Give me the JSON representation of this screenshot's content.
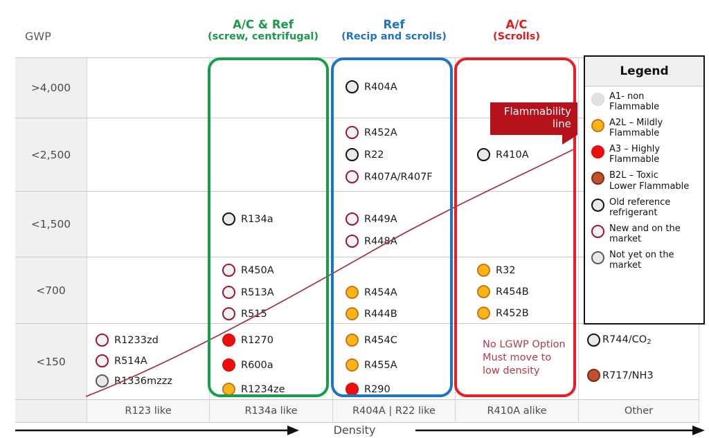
{
  "gwp_label": "GWP",
  "headers": [
    {
      "id": "green",
      "line1": "A/C & Ref",
      "line2": "(screw, centrifugal)",
      "color": "#1a9a4b"
    },
    {
      "id": "blue",
      "line1": "Ref",
      "line2": "(Recip and scrolls)",
      "color": "#1f72c4"
    },
    {
      "id": "red",
      "line1": "A/C",
      "line2": "(Scrolls)",
      "color": "#e01b1b"
    }
  ],
  "gwp_rows": [
    "&gt;4,000",
    "&lt;2,500",
    "&lt;1,500",
    "&lt;700",
    "&lt;150"
  ],
  "gwp_rows_plain": [
    ">4,000",
    "<2,500",
    "<1,500",
    "<700",
    "<150"
  ],
  "columns_footer": [
    "",
    "R123 like",
    "R134a like",
    "R404A | R22 like",
    "R410A alike",
    "Other"
  ],
  "density_label": "Density",
  "callout": {
    "line1": "Flammability",
    "line2": "line",
    "color": "#b5121b"
  },
  "no_lgwp_note": {
    "line1": "No LGWP Option",
    "line2": "Must move to",
    "line3": "low density",
    "color": "#b5394a"
  },
  "legend": {
    "title": "Legend",
    "entries": [
      {
        "class": "a1",
        "swatch": "a1-plain",
        "line1": "A1- non",
        "line2": "Flammable",
        "color": "#e0e2e6"
      },
      {
        "class": "a2l",
        "swatch": "a2l",
        "line1": "A2L – Mildly",
        "line2": "Flammable",
        "color": "#fcb415"
      },
      {
        "class": "a3",
        "swatch": "a3",
        "line1": "A3 – Highly",
        "line2": "Flammable",
        "color": "#f20d0d"
      },
      {
        "class": "b2l",
        "swatch": "b2l",
        "line1": "B2L – Toxic",
        "line2": "Lower Flammable",
        "color": "#c0512c"
      },
      {
        "class": "old",
        "swatch": "a1-old",
        "line1": "Old reference",
        "line2": "refrigerant",
        "color": "#111111"
      },
      {
        "class": "new",
        "swatch": "a1-new",
        "line1": "New and on the",
        "line2": "market",
        "color": "#9e1430"
      },
      {
        "class": "notyet",
        "swatch": "a1-not",
        "line1": "Not yet on the",
        "line2": "market",
        "color": "#595959"
      }
    ]
  },
  "chart_data": {
    "type": "table",
    "title": "Refrigerant GWP vs Density / Application Matrix",
    "xlabel": "Density",
    "ylabel": "GWP",
    "row_categories": [
      ">4,000",
      "<2,500",
      "<1,500",
      "<700",
      "<150"
    ],
    "column_categories": [
      "R123 like",
      "R134a like",
      "R404A | R22 like",
      "R410A alike",
      "Other"
    ],
    "application_groups": [
      {
        "label": "A/C & Ref (screw, centrifugal)",
        "columns": [
          "R134a like"
        ],
        "color": "#14a04a"
      },
      {
        "label": "Ref (Recip and scrolls)",
        "columns": [
          "R404A | R22 like"
        ],
        "color": "#1f72c4"
      },
      {
        "label": "A/C (Scrolls)",
        "columns": [
          "R410A alike"
        ],
        "color": "#ec1c24"
      }
    ],
    "cells": [
      {
        "row": ">4,000",
        "col": "R404A | R22 like",
        "items": [
          {
            "name": "R404A",
            "type": "a1-old"
          }
        ]
      },
      {
        "row": "<2,500",
        "col": "R404A | R22 like",
        "items": [
          {
            "name": "R452A",
            "type": "a1-new"
          },
          {
            "name": "R22",
            "type": "a1-old"
          },
          {
            "name": "R407A/R407F",
            "type": "a1-new"
          }
        ]
      },
      {
        "row": "<2,500",
        "col": "R410A alike",
        "items": [
          {
            "name": "R410A",
            "type": "a1-old"
          }
        ]
      },
      {
        "row": "<1,500",
        "col": "R134a like",
        "items": [
          {
            "name": "R134a",
            "type": "a1-old"
          }
        ]
      },
      {
        "row": "<1,500",
        "col": "R404A | R22 like",
        "items": [
          {
            "name": "R449A",
            "type": "a1-new"
          },
          {
            "name": "R448A",
            "type": "a1-new"
          }
        ]
      },
      {
        "row": "<700",
        "col": "R134a like",
        "items": [
          {
            "name": "R450A",
            "type": "a1-new"
          },
          {
            "name": "R513A",
            "type": "a1-new"
          },
          {
            "name": "R515",
            "type": "a1-new"
          }
        ]
      },
      {
        "row": "<700",
        "col": "R404A | R22 like",
        "items": [
          {
            "name": "R454A",
            "type": "a2l"
          },
          {
            "name": "R444B",
            "type": "a2l"
          }
        ]
      },
      {
        "row": "<700",
        "col": "R410A alike",
        "items": [
          {
            "name": "R32",
            "type": "a2l"
          },
          {
            "name": "R454B",
            "type": "a2l"
          },
          {
            "name": "R452B",
            "type": "a2l"
          }
        ]
      },
      {
        "row": "<150",
        "col": "R123 like",
        "items": [
          {
            "name": "R1233zd",
            "type": "a1-new"
          },
          {
            "name": "R514A",
            "type": "a1-new"
          },
          {
            "name": "R1336mzzz",
            "type": "a1-not"
          }
        ]
      },
      {
        "row": "<150",
        "col": "R134a like",
        "items": [
          {
            "name": "R1270",
            "type": "a3"
          },
          {
            "name": "R600a",
            "type": "a3"
          },
          {
            "name": "R1234ze",
            "type": "a2l"
          }
        ]
      },
      {
        "row": "<150",
        "col": "R404A | R22 like",
        "items": [
          {
            "name": "R454C",
            "type": "a2l"
          },
          {
            "name": "R455A",
            "type": "a2l"
          },
          {
            "name": "R290",
            "type": "a3"
          }
        ]
      },
      {
        "row": "<150",
        "col": "R410A alike",
        "items": []
      },
      {
        "row": "<150",
        "col": "Other",
        "items": [
          {
            "name": "R744/CO2",
            "type": "a1-old"
          },
          {
            "name": "R717/NH3",
            "type": "b2l"
          }
        ]
      },
      {
        "row": "<1,500",
        "col": "Other",
        "items": []
      }
    ],
    "annotations": [
      {
        "text": "Flammability line",
        "kind": "callout"
      },
      {
        "text": "No LGWP Option Must move to low density",
        "kind": "note"
      }
    ]
  },
  "entries": {
    "r404a": "R404A",
    "r452a": "R452A",
    "r22": "R22",
    "r407": "R407A/R407F",
    "r410a": "R410A",
    "r134a": "R134a",
    "r449a": "R449A",
    "r448a": "R448A",
    "r450a": "R450A",
    "r513a": "R513A",
    "r515": "R515",
    "r454a": "R454A",
    "r444b": "R444B",
    "r32": "R32",
    "r454b": "R454B",
    "r452b": "R452B",
    "r1233zd": "R1233zd",
    "r514a": "R514A",
    "r1336mzzz": "R1336mzzz",
    "r1270": "R1270",
    "r600a": "R600a",
    "r1234ze": "R1234ze",
    "r454c": "R454C",
    "r455a": "R455A",
    "r290": "R290",
    "r744": "R744/CO",
    "r744sub": "2",
    "r717": "R717/NH3"
  }
}
